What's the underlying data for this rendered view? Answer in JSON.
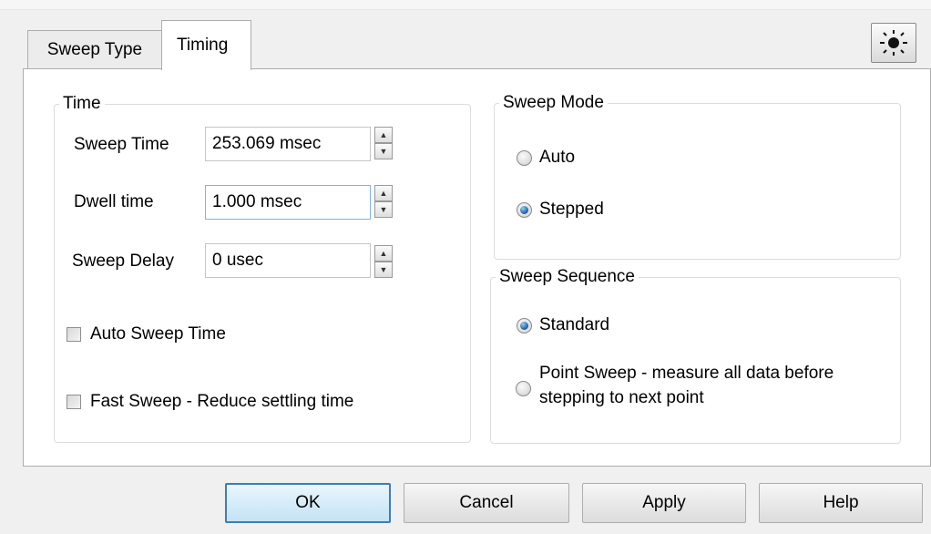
{
  "tabs": {
    "sweep_type": "Sweep Type",
    "timing": "Timing"
  },
  "icons": {
    "theme": "sun-icon",
    "spin_up": "spin-up-arrow-icon",
    "spin_down": "spin-down-arrow-icon"
  },
  "time_group": {
    "title": "Time",
    "sweep_time": {
      "label": "Sweep Time",
      "value": "253.069 msec"
    },
    "dwell_time": {
      "label": "Dwell time",
      "value": "1.000 msec"
    },
    "sweep_delay": {
      "label": "Sweep Delay",
      "value": "0 usec"
    },
    "auto_sweep_time": {
      "label": "Auto Sweep Time",
      "checked": false
    },
    "fast_sweep": {
      "label": "Fast Sweep - Reduce settling time",
      "checked": false
    }
  },
  "sweep_mode_group": {
    "title": "Sweep Mode",
    "options": [
      {
        "label": "Auto",
        "checked": false
      },
      {
        "label": "Stepped",
        "checked": true
      }
    ]
  },
  "sweep_sequence_group": {
    "title": "Sweep Sequence",
    "options": [
      {
        "label": "Standard",
        "checked": true
      },
      {
        "label_line1": "Point Sweep - measure all data before",
        "label_line2": "stepping to next point",
        "checked": false
      }
    ]
  },
  "buttons": {
    "ok": "OK",
    "cancel": "Cancel",
    "apply": "Apply",
    "help": "Help"
  },
  "colors": {
    "ok_border": "#3c7fb1",
    "radio_selected": "#1c5aa0"
  }
}
